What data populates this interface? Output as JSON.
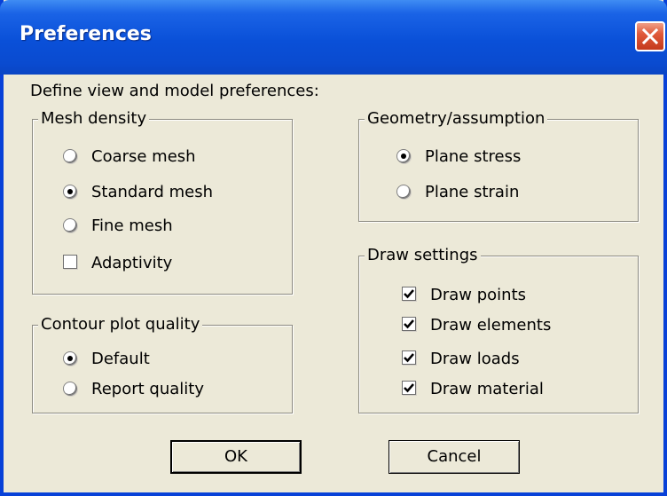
{
  "window": {
    "title": "Preferences"
  },
  "intro": "Define view and model preferences:",
  "mesh": {
    "title": "Mesh density",
    "options": [
      {
        "label": "Coarse mesh",
        "selected": false
      },
      {
        "label": "Standard mesh",
        "selected": true
      },
      {
        "label": "Fine mesh",
        "selected": false
      }
    ],
    "adaptivity": {
      "label": "Adaptivity",
      "checked": false
    }
  },
  "contour": {
    "title": "Contour plot quality",
    "options": [
      {
        "label": "Default",
        "selected": true
      },
      {
        "label": "Report quality",
        "selected": false
      }
    ]
  },
  "geometry": {
    "title": "Geometry/assumption",
    "options": [
      {
        "label": "Plane stress",
        "selected": true
      },
      {
        "label": "Plane strain",
        "selected": false
      }
    ]
  },
  "draw": {
    "title": "Draw settings",
    "items": [
      {
        "label": "Draw points",
        "checked": true
      },
      {
        "label": "Draw elements",
        "checked": true
      },
      {
        "label": "Draw loads",
        "checked": true
      },
      {
        "label": "Draw material",
        "checked": true
      }
    ]
  },
  "buttons": {
    "ok": "OK",
    "cancel": "Cancel"
  },
  "colors": {
    "titlebar": "#0a50d8",
    "dialog_bg": "#ece9d8",
    "close_button": "#e05a3a"
  }
}
